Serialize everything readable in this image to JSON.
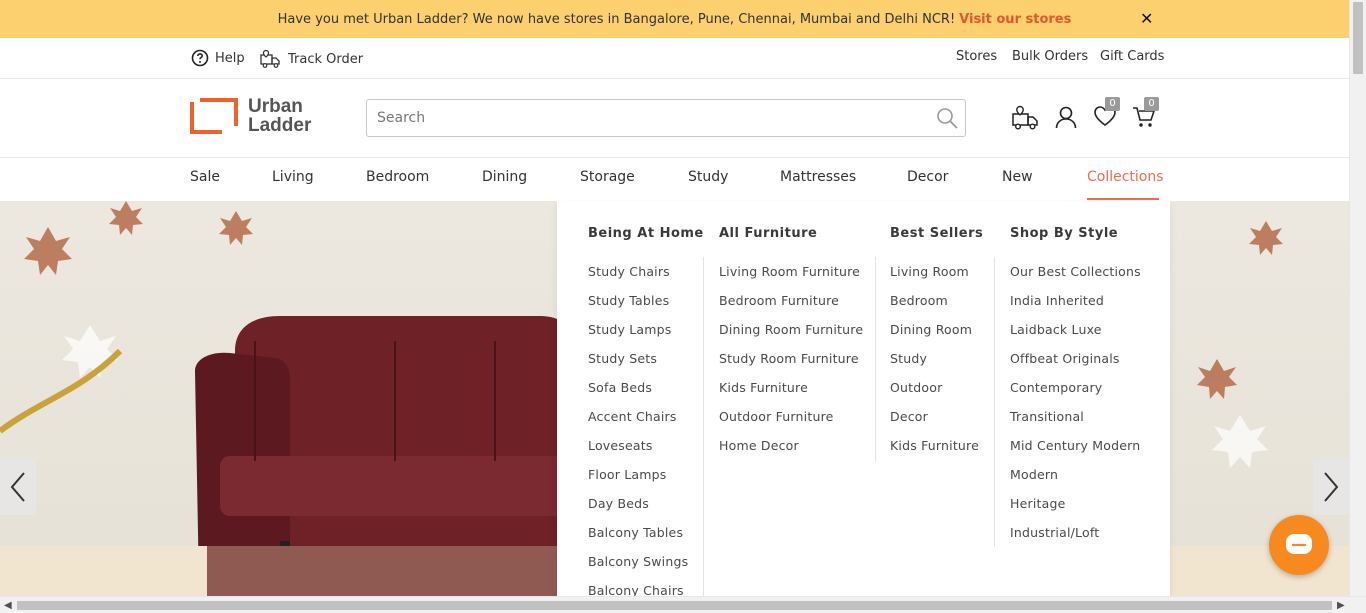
{
  "announcement": {
    "text": "Have you met Urban Ladder? We now have stores in Bangalore, Pune, Chennai, Mumbai and Delhi NCR!",
    "link": "Visit our stores",
    "close": "✕"
  },
  "utility": {
    "help": "Help",
    "track_order": "Track Order",
    "stores": "Stores",
    "bulk_orders": "Bulk Orders",
    "gift_cards": "Gift Cards"
  },
  "logo": {
    "line1": "Urban",
    "line2": "Ladder"
  },
  "search": {
    "placeholder": "Search"
  },
  "header_icons": {
    "wishlist_count": "0",
    "cart_count": "0"
  },
  "nav": {
    "items": [
      "Sale",
      "Living",
      "Bedroom",
      "Dining",
      "Storage",
      "Study",
      "Mattresses",
      "Decor",
      "New",
      "Collections"
    ],
    "active": "Collections"
  },
  "mega_menu": {
    "columns": [
      {
        "heading": "Being At Home",
        "items": [
          "Study Chairs",
          "Study Tables",
          "Study Lamps",
          "Study Sets",
          "Sofa Beds",
          "Accent Chairs",
          "Loveseats",
          "Floor Lamps",
          "Day Beds",
          "Balcony Tables",
          "Balcony Swings",
          "Balcony Chairs"
        ]
      },
      {
        "heading": "All Furniture",
        "items": [
          "Living Room Furniture",
          "Bedroom Furniture",
          "Dining Room Furniture",
          "Study Room Furniture",
          "Kids Furniture",
          "Outdoor Furniture",
          "Home Decor"
        ]
      },
      {
        "heading": "Best Sellers",
        "items": [
          "Living Room",
          "Bedroom",
          "Dining Room",
          "Study",
          "Outdoor",
          "Decor",
          "Kids Furniture"
        ]
      },
      {
        "heading": "Shop By Style",
        "items": [
          "Our Best Collections",
          "India Inherited",
          "Laidback Luxe",
          "Offbeat Originals",
          "Contemporary",
          "Transitional",
          "Mid Century Modern",
          "Modern",
          "Heritage",
          "Industrial/Loft"
        ]
      }
    ]
  },
  "colors": {
    "announcement_bg": "#fcd06e",
    "accent": "#f26c4f",
    "chat_button": "#f78a1e"
  }
}
